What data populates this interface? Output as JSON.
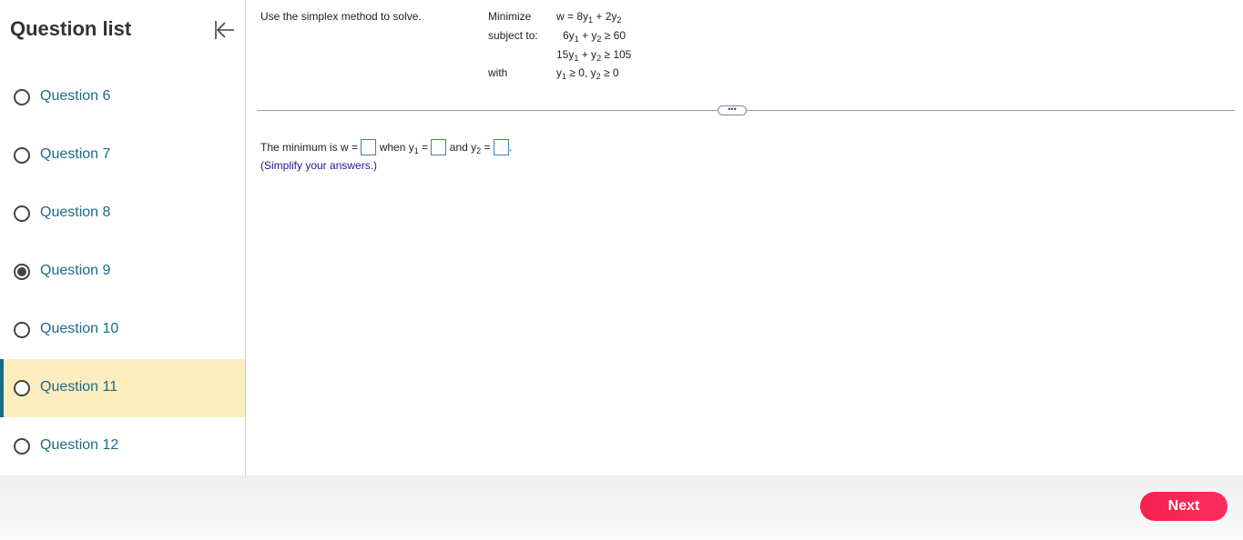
{
  "sidebar": {
    "title": "Question list",
    "items": [
      {
        "label": "Question 6",
        "checked": false,
        "active": false
      },
      {
        "label": "Question 7",
        "checked": false,
        "active": false
      },
      {
        "label": "Question 8",
        "checked": false,
        "active": false
      },
      {
        "label": "Question 9",
        "checked": true,
        "active": false
      },
      {
        "label": "Question 10",
        "checked": false,
        "active": false
      },
      {
        "label": "Question 11",
        "checked": false,
        "active": true
      },
      {
        "label": "Question 12",
        "checked": false,
        "active": false
      }
    ]
  },
  "problem": {
    "instruction": "Use the simplex method to solve.",
    "minimize_label": "Minimize",
    "subject_label": "subject to:",
    "with_label": "with",
    "objective": {
      "lhs": "w = 8y",
      "sub1": "1",
      "mid": " + 2y",
      "sub2": "2"
    },
    "c1": {
      "a": "6y",
      "s1": "1",
      "b": " + y",
      "s2": "2",
      "rel": " ≥ 60"
    },
    "c2": {
      "a": "15y",
      "s1": "1",
      "b": " + y",
      "s2": "2",
      "rel": " ≥ 105"
    },
    "c3": {
      "a": "y",
      "s1": "1",
      "b": " ≥ 0, y",
      "s2": "2",
      "rel": " ≥ 0"
    }
  },
  "more_button": "•••",
  "answer": {
    "prefix": "The minimum is w =",
    "when": "when y",
    "when_sub": "1",
    "eq": " =",
    "and": "and y",
    "and_sub": "2",
    "eq2": " =",
    "period": ".",
    "hint": "(Simplify your answers.)"
  },
  "footer": {
    "next_label": "Next"
  },
  "colors": {
    "accent": "#1a6b8a",
    "active_bg": "#fbedbd",
    "next": "#f5204e",
    "hint": "#1b1c8a"
  }
}
